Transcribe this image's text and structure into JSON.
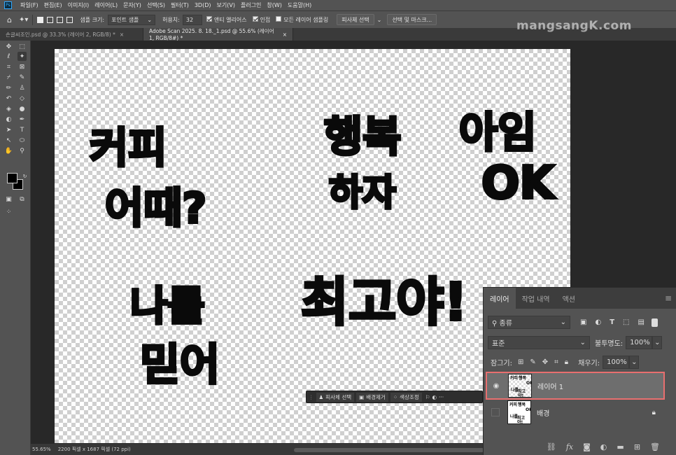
{
  "menu": [
    "파일(F)",
    "편집(E)",
    "이미지(I)",
    "레이어(L)",
    "문자(Y)",
    "선택(S)",
    "필터(T)",
    "3D(D)",
    "보기(V)",
    "플러그인",
    "창(W)",
    "도움말(H)"
  ],
  "options": {
    "sample_size_label": "샘플 크기:",
    "sample_size_value": "포인트 샘플",
    "tolerance_label": "허용치:",
    "tolerance_value": "32",
    "antialias_label": "앤티 앨리어스",
    "contiguous_label": "인접",
    "all_layers_label": "모든 레이어 샘플링",
    "subject_select_label": "피사체 선택",
    "select_mask_label": "선택 및 마스크..."
  },
  "doc_tabs": [
    {
      "label": "손글씨조인.psd @ 33.3% (레이어 2, RGB/8) *",
      "close": "×"
    },
    {
      "label": "Adobe Scan 2025. 8. 18._1.psd @ 55.6% (레이어 1, RGB/8#) *",
      "close": "×"
    }
  ],
  "watermark": "mangsangK.com",
  "canvas_art": {
    "t1": "커피",
    "t2": "어때?",
    "t3": "행복",
    "t4": "하자",
    "t5": "아임",
    "t6": "OK",
    "t7": "나를",
    "t8": "믿어",
    "t9": "최고야!"
  },
  "contextual_bar": {
    "subject": "피사체 선택",
    "remove_bg": "배경제거",
    "color_adjust": "색상조정",
    "more": "···"
  },
  "status": {
    "zoom": "55.65%",
    "doc_info": "2200 픽셀 x 1687 픽셀 (72 ppi)"
  },
  "layers_panel": {
    "tabs": [
      "레이어",
      "작업 내역",
      "액션"
    ],
    "filter_label": "종류",
    "blend_mode": "표준",
    "opacity_label": "불투명도:",
    "opacity_value": "100%",
    "lock_label": "잠그기:",
    "fill_label": "채우기:",
    "fill_value": "100%",
    "layers": [
      {
        "name": "레이어 1",
        "visible": true,
        "selected": true
      },
      {
        "name": "배경",
        "visible": false,
        "locked": true
      }
    ],
    "highlight_color": "#e86f6f"
  },
  "colors": {
    "ui_bg": "#535353",
    "dark_bg": "#282828",
    "accent": "#31a8ff"
  }
}
